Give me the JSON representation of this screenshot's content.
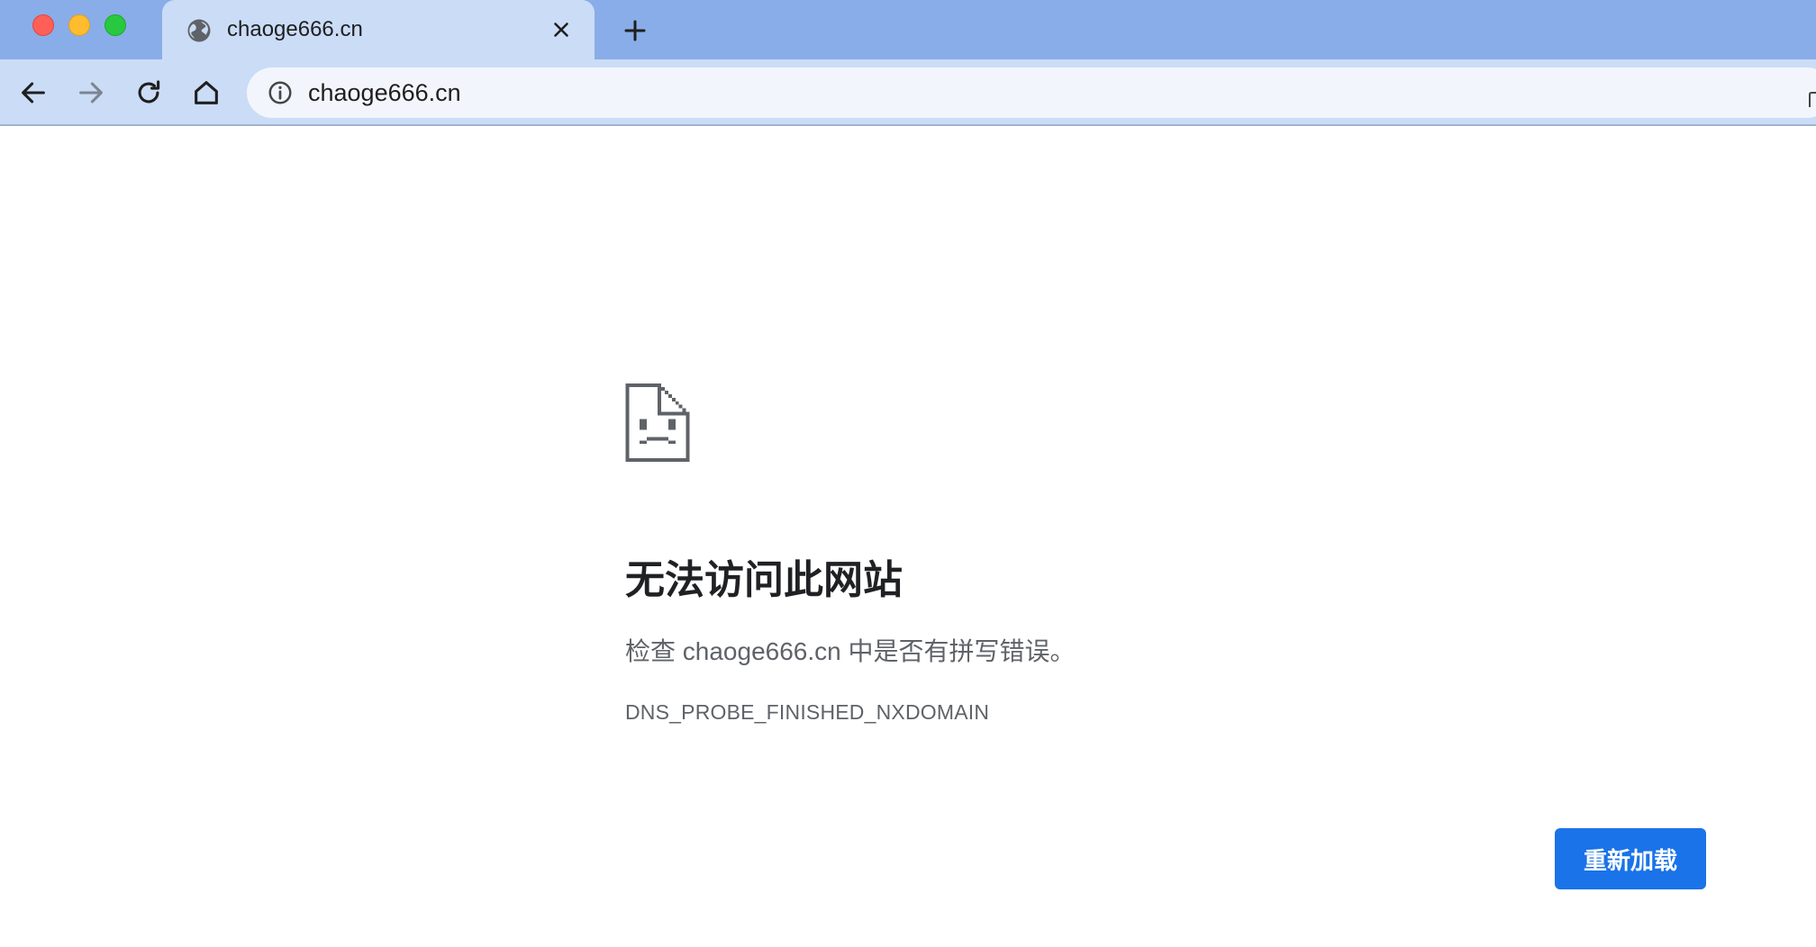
{
  "tab": {
    "title": "chaoge666.cn",
    "favicon": "globe-icon"
  },
  "toolbar": {
    "back_icon": "arrow-left-icon",
    "forward_icon": "arrow-right-icon",
    "reload_icon": "reload-icon",
    "home_icon": "home-icon"
  },
  "omnibox": {
    "url": "chaoge666.cn",
    "info_icon": "info-icon"
  },
  "error": {
    "icon": "sad-document-icon",
    "title": "无法访问此网站",
    "suggestion": "检查 chaoge666.cn 中是否有拼写错误。",
    "code": "DNS_PROBE_FINISHED_NXDOMAIN",
    "reload_label": "重新加载"
  },
  "colors": {
    "tab_strip": "#89ade8",
    "toolbar": "#cbdcf7",
    "accent": "#1a73e8",
    "traffic_red": "#fe5f57",
    "traffic_yellow": "#febc2e",
    "traffic_green": "#28c840"
  }
}
